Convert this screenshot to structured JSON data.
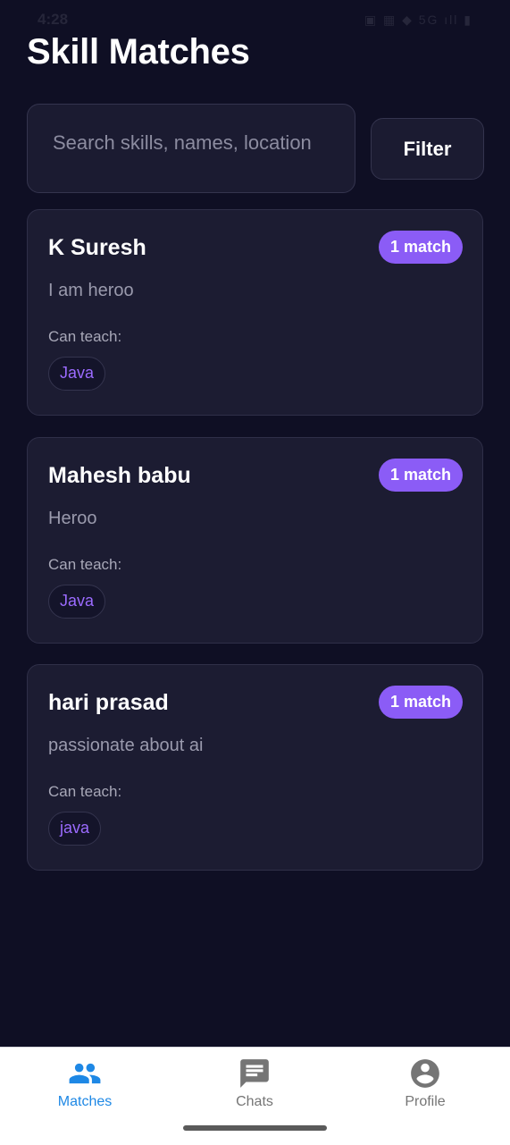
{
  "status_bar": {
    "time": "4:28",
    "icons": "▣ ▦ ◆ 5G ıll ▮"
  },
  "header": {
    "title": "Skill Matches"
  },
  "search": {
    "placeholder": "Search skills, names, location",
    "value": ""
  },
  "filter": {
    "label": "Filter"
  },
  "matches": [
    {
      "name": "K Suresh",
      "badge": "1 match",
      "bio": "I am heroo",
      "can_teach_label": "Can teach:",
      "skills": [
        "Java"
      ]
    },
    {
      "name": "Mahesh babu",
      "badge": "1 match",
      "bio": "Heroo",
      "can_teach_label": "Can teach:",
      "skills": [
        "Java"
      ]
    },
    {
      "name": "hari prasad",
      "badge": "1 match",
      "bio": "passionate about ai",
      "can_teach_label": "Can teach:",
      "skills": [
        "java"
      ]
    }
  ],
  "bottom_nav": {
    "items": [
      {
        "label": "Matches",
        "icon": "people-icon",
        "active": true
      },
      {
        "label": "Chats",
        "icon": "chat-icon",
        "active": false
      },
      {
        "label": "Profile",
        "icon": "account-circle-icon",
        "active": false
      }
    ],
    "active_color": "#1e88e5",
    "inactive_color": "#757575"
  },
  "colors": {
    "background": "#0f0f24",
    "card": "#1c1c32",
    "accent": "#8b5cf6",
    "chip_text": "#9b6bff"
  }
}
